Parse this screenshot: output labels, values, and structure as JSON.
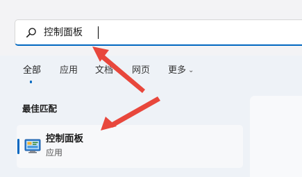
{
  "search": {
    "value": "控制面板",
    "icon": "search-icon"
  },
  "tabs": [
    {
      "label": "全部",
      "active": true
    },
    {
      "label": "应用",
      "active": false
    },
    {
      "label": "文档",
      "active": false
    },
    {
      "label": "网页",
      "active": false
    },
    {
      "label": "更多",
      "active": false,
      "has_dropdown": true
    }
  ],
  "section": {
    "title": "最佳匹配"
  },
  "best_match": {
    "name": "控制面板",
    "type": "应用",
    "icon": "control-panel-icon"
  },
  "colors": {
    "accent": "#0067c0",
    "annotation_arrow": "#e8473c"
  }
}
